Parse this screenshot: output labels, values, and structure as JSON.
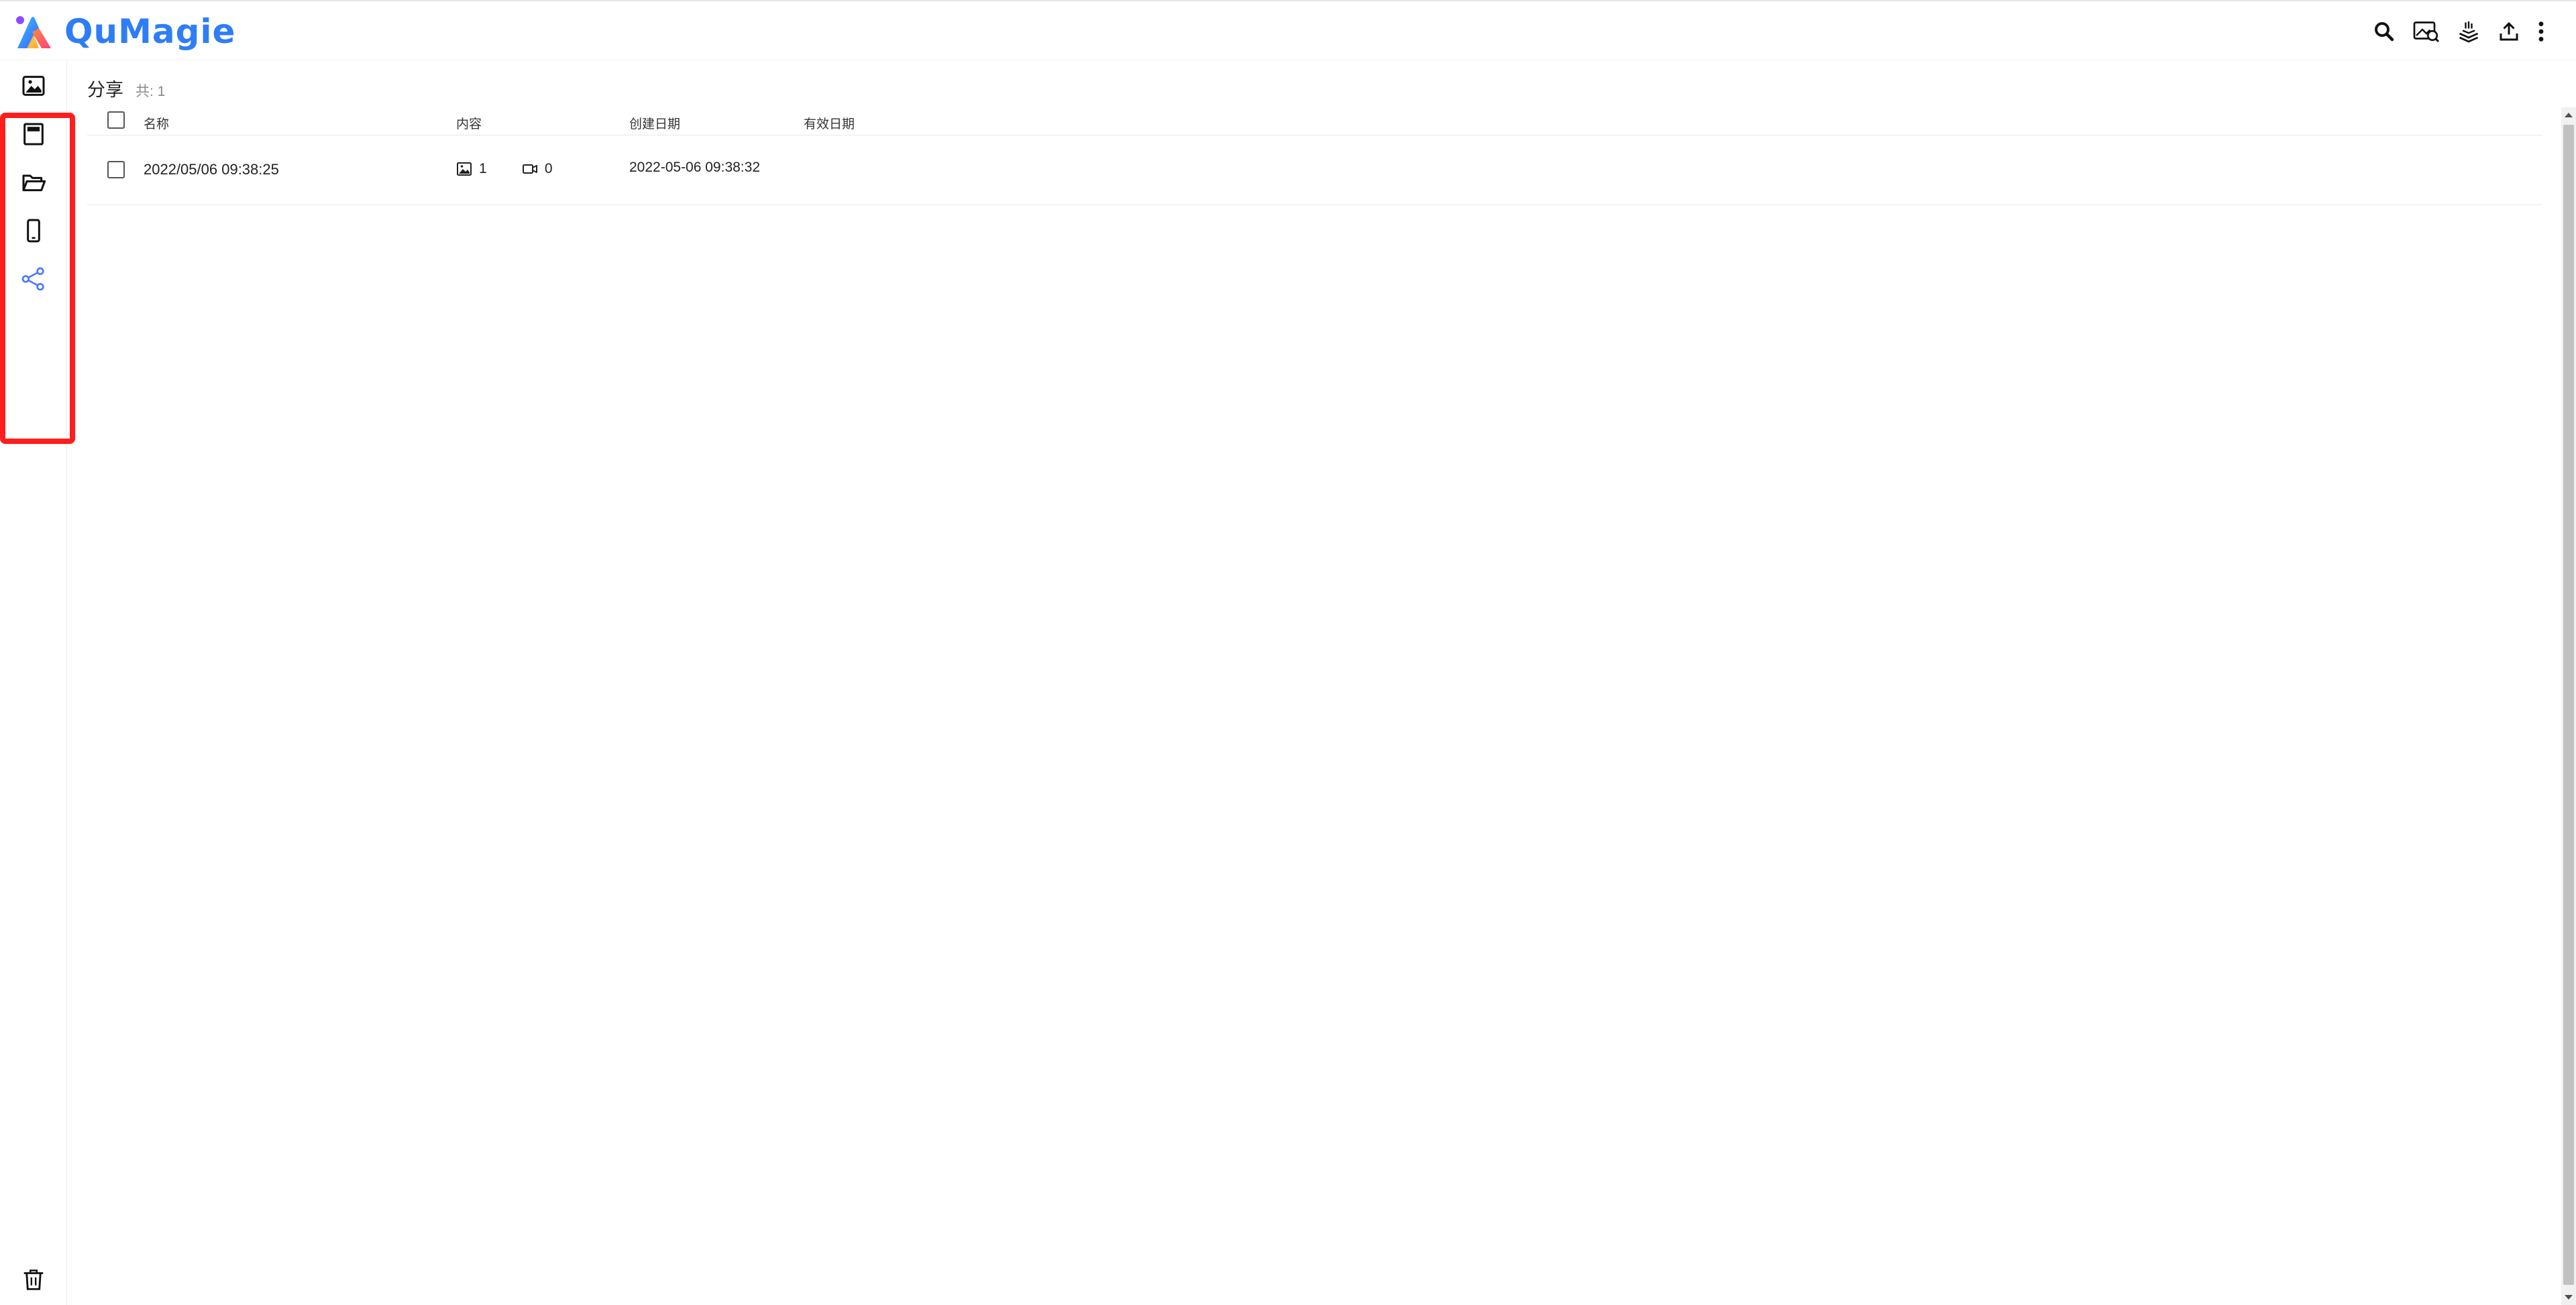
{
  "app": {
    "name": "QuMagie"
  },
  "toolbar": {
    "icons": [
      "search-icon",
      "smart-search-icon",
      "background-tasks-icon",
      "upload-icon",
      "more-vertical-icon"
    ]
  },
  "sidebar": {
    "items": [
      {
        "id": "photos",
        "icon": "image-icon",
        "active": false
      },
      {
        "id": "albums",
        "icon": "album-icon",
        "active": false
      },
      {
        "id": "folders",
        "icon": "folder-open-icon",
        "active": false
      },
      {
        "id": "devices",
        "icon": "mobile-icon",
        "active": false
      },
      {
        "id": "share",
        "icon": "share-icon",
        "active": true
      }
    ],
    "bottom": {
      "id": "trash",
      "icon": "trash-icon"
    },
    "highlight_color": "#ff1e1e",
    "active_color": "#4a78ff"
  },
  "page": {
    "title": "分享",
    "count_label": "共: 1"
  },
  "table": {
    "columns": {
      "name": "名称",
      "content": "内容",
      "created": "创建日期",
      "expires": "有效日期"
    },
    "rows": [
      {
        "name": "2022/05/06 09:38:25",
        "photos": "1",
        "videos": "0",
        "created": "2022-05-06 09:38:32",
        "expires": ""
      }
    ]
  },
  "colors": {
    "brand": "#2f7df6",
    "text": "#222222",
    "muted": "#888888"
  }
}
